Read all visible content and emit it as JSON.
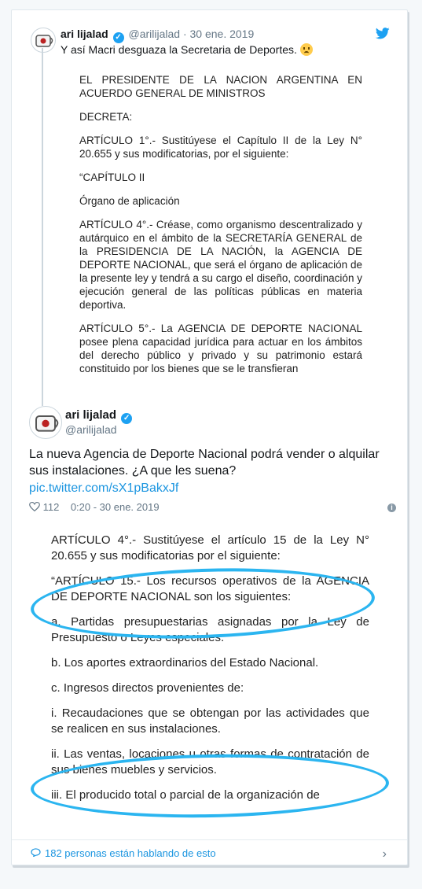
{
  "quoted": {
    "name": "ari lijalad",
    "handle": "@arilijalad",
    "date": "· 30 ene. 2019",
    "text": "Y así Macri desguaza la Secretaria de Deportes.",
    "emoji": "disappointed-relieved-face",
    "document": [
      "EL PRESIDENTE DE LA NACION ARGENTINA EN ACUERDO GENERAL DE MINISTROS",
      "DECRETA:",
      "ARTÍCULO 1°.- Sustitúyese el Capítulo II de la Ley N° 20.655 y sus modificatorias, por el siguiente:",
      "“CAPÍTULO II",
      "Órgano de aplicación",
      "ARTÍCULO 4°.- Créase, como organismo descentralizado y autárquico en el ámbito de la SECRETARÍA GENERAL de la PRESIDENCIA DE LA NACIÓN, la AGENCIA DE DEPORTE NACIONAL, que será el órgano de aplicación de la presente ley y tendrá a su cargo el diseño, coordinación y ejecución general de las políticas públicas en materia deportiva.",
      "ARTÍCULO 5°.- La AGENCIA DE DEPORTE NACIONAL posee plena capacidad jurídica para actuar en los ámbitos del derecho público y privado y su patrimonio estará constituido por los bienes que se le transfieran"
    ]
  },
  "tweet": {
    "name": "ari lijalad",
    "handle": "@arilijalad",
    "text": "La nueva Agencia de Deporte Nacional podrá vender o alquilar sus instalaciones. ¿A que les suena?",
    "link": "pic.twitter.com/sX1pBakxJf",
    "likes": "112",
    "time": "0:20 - 30 ene. 2019",
    "document": [
      "ARTÍCULO 4°.- Sustitúyese el artículo 15 de la Ley N° 20.655 y sus modificatorias por el siguiente:",
      "“ARTÍCULO 15.- Los recursos operativos de la AGENCIA DE DEPORTE NACIONAL son los siguientes:",
      "a. Partidas presupuestarias asignadas por la Ley de Presupuesto o Leyes especiales.",
      "b. Los aportes extraordinarios del Estado Nacional.",
      "c. Ingresos directos provenientes de:",
      "i. Recaudaciones que se obtengan por las actividades que se realicen en sus instalaciones.",
      "ii. Las ventas, locaciones u otras formas de contratación de sus bienes muebles y servicios.",
      "iii. El producido total o parcial de la organización de"
    ]
  },
  "footer": {
    "talking": "182 personas están hablando de esto"
  },
  "colors": {
    "accent": "#1da1f2",
    "link": "#1b95e0",
    "highlight": "#2bb5f0"
  }
}
